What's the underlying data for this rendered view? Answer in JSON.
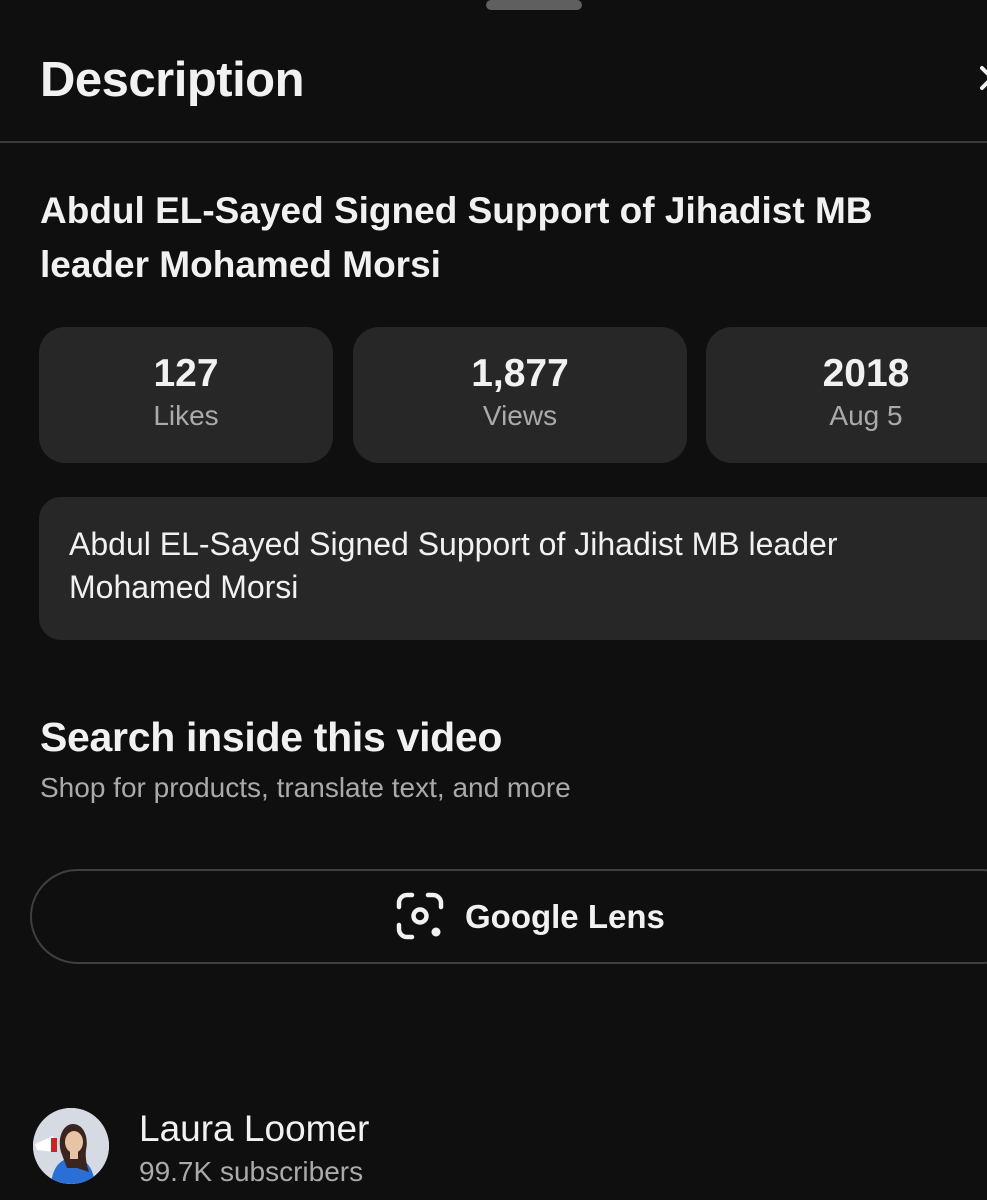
{
  "header": {
    "title": "Description"
  },
  "video": {
    "title": "Abdul EL-Sayed Signed Support of Jihadist MB leader Mohamed Morsi"
  },
  "stats": {
    "likes": {
      "value": "127",
      "label": "Likes"
    },
    "views": {
      "value": "1,877",
      "label": "Views"
    },
    "date": {
      "year": "2018",
      "day": "Aug 5"
    }
  },
  "description": {
    "text": "Abdul EL-Sayed Signed Support of Jihadist MB leader Mohamed Morsi"
  },
  "search_section": {
    "title": "Search inside this video",
    "subtitle": "Shop for products, translate text, and more",
    "button_label": "Google Lens",
    "button_icon": "google-lens-icon"
  },
  "channel": {
    "name": "Laura Loomer",
    "subscribers": "99.7K subscribers",
    "avatar_icon": "avatar"
  },
  "colors": {
    "background": "#0f0f0f",
    "card": "#272727",
    "muted_text": "#aaaaaa"
  }
}
